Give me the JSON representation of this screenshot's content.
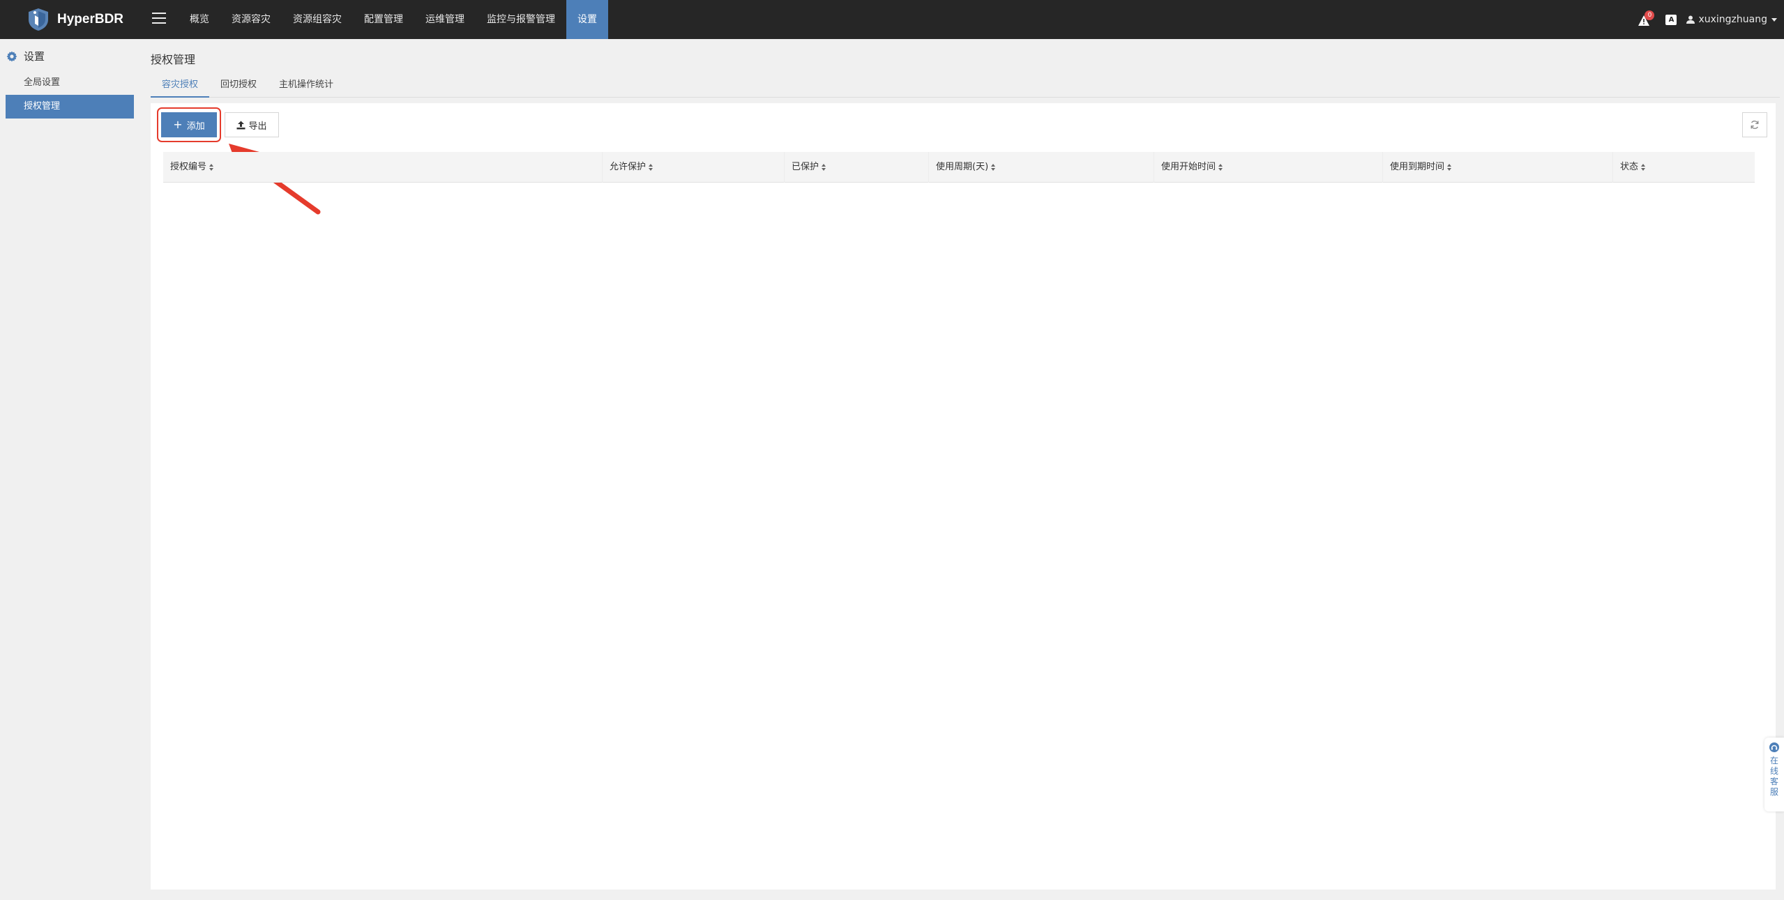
{
  "app": {
    "name": "HyperBDR"
  },
  "nav": {
    "items": [
      "概览",
      "资源容灾",
      "资源组容灾",
      "配置管理",
      "运维管理",
      "监控与报警管理",
      "设置"
    ],
    "active_index": 6
  },
  "header": {
    "alert_count": "0",
    "lang_label": "A",
    "username": "xuxingzhuang"
  },
  "sidebar": {
    "title": "设置",
    "items": [
      {
        "label": "全局设置",
        "active": false
      },
      {
        "label": "授权管理",
        "active": true
      }
    ]
  },
  "main": {
    "page_title": "授权管理",
    "tabs": [
      {
        "label": "容灾授权",
        "active": true
      },
      {
        "label": "回切授权",
        "active": false
      },
      {
        "label": "主机操作统计",
        "active": false
      }
    ],
    "toolbar": {
      "add_label": "添加",
      "export_label": "导出"
    },
    "table": {
      "columns": [
        "授权编号",
        "允许保护",
        "已保护",
        "使用周期(天)",
        "使用开始时间",
        "使用到期时间",
        "状态"
      ],
      "rows": []
    }
  },
  "service": {
    "label": "在线客服"
  },
  "colors": {
    "topbar": "#262626",
    "accent": "#4d7fb8",
    "annotation": "#e53b2c"
  }
}
